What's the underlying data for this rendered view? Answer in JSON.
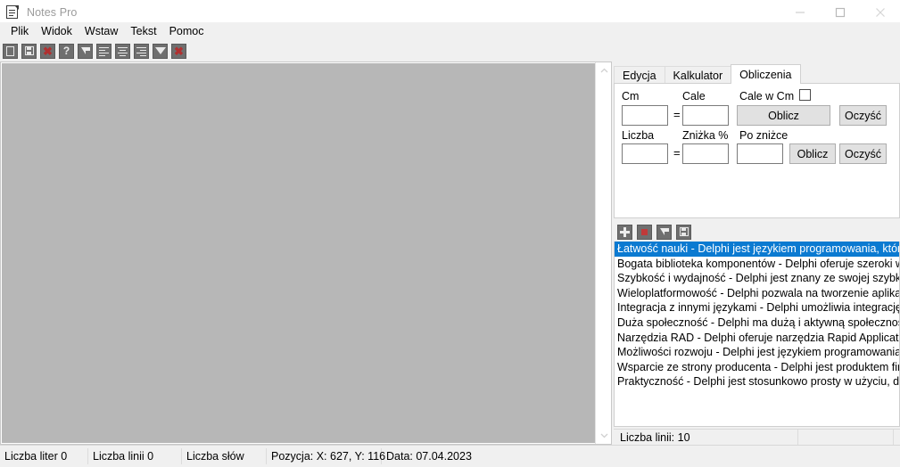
{
  "window": {
    "title": "Notes Pro",
    "icon": "notes-document-icon",
    "controls": {
      "minimize": "minimize-icon",
      "maximize": "maximize-icon",
      "close": "close-icon"
    }
  },
  "menubar": {
    "items": [
      {
        "label": "Plik"
      },
      {
        "label": "Widok"
      },
      {
        "label": "Wstaw"
      },
      {
        "label": "Tekst"
      },
      {
        "label": "Pomoc"
      }
    ]
  },
  "toolbar": {
    "buttons": [
      {
        "icon": "new-document-icon",
        "title": "Nowy"
      },
      {
        "icon": "save-disk-icon",
        "title": "Zapisz"
      },
      {
        "icon": "delete-red-x-icon",
        "title": "Usuń"
      },
      {
        "icon": "help-question-icon",
        "title": "Pomoc"
      },
      {
        "icon": "flag-pointer-icon",
        "title": "Zaznacz"
      },
      {
        "icon": "align-left-icon",
        "title": "Wyrównaj do lewej"
      },
      {
        "icon": "align-center-icon",
        "title": "Wyśrodkuj"
      },
      {
        "icon": "align-right-icon",
        "title": "Wyrównaj do prawej"
      },
      {
        "icon": "filter-funnel-icon",
        "title": "Filtr"
      },
      {
        "icon": "close-red-x-icon",
        "title": "Zamknij"
      }
    ]
  },
  "editor": {
    "content": "",
    "scrollbar": {
      "up": "chevron-up-icon",
      "down": "chevron-down-icon"
    }
  },
  "right_panel": {
    "tabs": [
      {
        "label": "Edycja",
        "active": false
      },
      {
        "label": "Kalkulator",
        "active": false
      },
      {
        "label": "Obliczenia",
        "active": true
      }
    ],
    "calc": {
      "row1": {
        "label_cm": "Cm",
        "label_cale": "Cale",
        "label_cale_w_cm": "Cale w  Cm",
        "value_cm": "",
        "value_cale": "",
        "equals": "=",
        "checkbox_checked": false,
        "btn_compute": "Oblicz",
        "btn_clear": "Oczyść"
      },
      "row2": {
        "label_liczba": "Liczba",
        "label_znizka": "Zniżka %",
        "label_po_znizce": "Po zniżce",
        "value_liczba": "",
        "value_znizka": "",
        "value_po_znizce": "",
        "equals": "=",
        "btn_compute": "Oblicz",
        "btn_clear": "Oczyść"
      }
    },
    "list_toolbar": {
      "buttons": [
        {
          "icon": "add-plus-icon",
          "title": "Dodaj"
        },
        {
          "icon": "delete-red-square-icon",
          "title": "Usuń"
        },
        {
          "icon": "flag-pointer-icon",
          "title": "Zaznacz"
        },
        {
          "icon": "save-disk-icon",
          "title": "Zapisz"
        }
      ]
    },
    "list": {
      "items": [
        {
          "text": "Łatwość nauki - Delphi jest językiem programowania, który j",
          "selected": true
        },
        {
          "text": "Bogata biblioteka komponentów - Delphi oferuje szeroki wy",
          "selected": false
        },
        {
          "text": "Szybkość i wydajność - Delphi jest znany ze swojej szybkości",
          "selected": false
        },
        {
          "text": "Wieloplatformowość - Delphi pozwala na tworzenie aplikacji",
          "selected": false
        },
        {
          "text": "Integracja z innymi językami - Delphi umożliwia integrację z",
          "selected": false
        },
        {
          "text": "Duża społeczność - Delphi ma dużą i aktywną społeczność p",
          "selected": false
        },
        {
          "text": "Narzędzia RAD - Delphi oferuje narzędzia Rapid Application I",
          "selected": false
        },
        {
          "text": "Możliwości rozwoju - Delphi jest językiem programowania, k",
          "selected": false
        },
        {
          "text": "Wsparcie ze strony producenta - Delphi jest produktem firm",
          "selected": false
        },
        {
          "text": "Praktyczność - Delphi jest stosunkowo prosty w użyciu, dzięk",
          "selected": false
        }
      ]
    },
    "status": {
      "lines": "Liczba linii: 10",
      "cell2": "",
      "cell3": ""
    }
  },
  "statusbar": {
    "cells": [
      {
        "label": "Liczba liter 0"
      },
      {
        "label": "Liczba linii 0"
      },
      {
        "label": "Liczba słów"
      },
      {
        "label": "Pozycja: X: 627, Y: 116"
      },
      {
        "label": "Data: 07.04.2023"
      }
    ]
  },
  "colors": {
    "selection": "#0b7ad1",
    "editor_bg": "#b7b7b7",
    "chrome": "#f0f0f0",
    "accent_red": "#b03030"
  }
}
